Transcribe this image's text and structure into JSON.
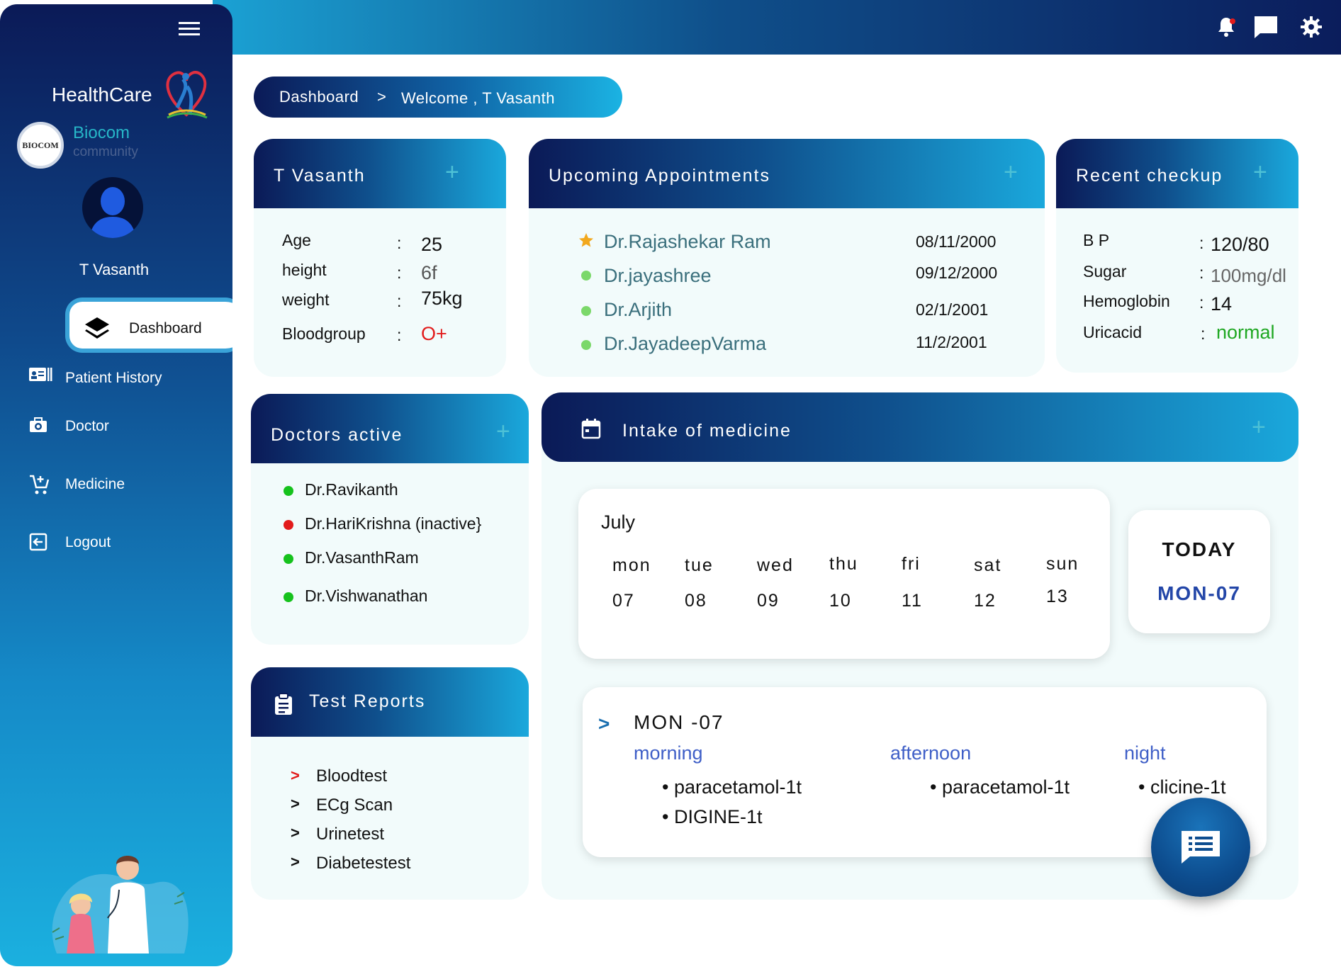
{
  "app": {
    "brand": "HealthCare",
    "org_name": "Biocom",
    "org_sub": "community",
    "org_logo_text": "BIOCOM",
    "user_name": "T Vasanth"
  },
  "nav": {
    "dashboard": "Dashboard",
    "patient_history": "Patient History",
    "doctor": "Doctor",
    "medicine": "Medicine",
    "logout": "Logout"
  },
  "breadcrumb": {
    "home": "Dashboard",
    "separator": ">",
    "current": "Welcome , T Vasanth"
  },
  "profile": {
    "title": "T Vasanth",
    "rows": [
      {
        "label": "Age",
        "sep": ":",
        "value": "25"
      },
      {
        "label": "height",
        "sep": ":",
        "value": "6f"
      },
      {
        "label": "weight",
        "sep": ":",
        "value": "75kg"
      },
      {
        "label": "Bloodgroup",
        "sep": ":",
        "value": "O+"
      }
    ]
  },
  "appointments": {
    "title": "Upcoming Appointments",
    "items": [
      {
        "doctor": "Dr.Rajashekar Ram",
        "date": "08/11/2000"
      },
      {
        "doctor": "Dr.jayashree",
        "date": "09/12/2000"
      },
      {
        "doctor": "Dr.Arjith",
        "date": "02/1/2001"
      },
      {
        "doctor": "Dr.JayadeepVarma",
        "date": "11/2/2001"
      }
    ]
  },
  "checkup": {
    "title": "Recent checkup",
    "rows": [
      {
        "label": "B P",
        "sep": ":",
        "value": "120/80"
      },
      {
        "label": "Sugar",
        "sep": ":",
        "value": "100mg/dl"
      },
      {
        "label": "Hemoglobin",
        "sep": ":",
        "value": "14"
      },
      {
        "label": "Uricacid",
        "sep": ":",
        "value": "normal"
      }
    ]
  },
  "doctors_active": {
    "title": "Doctors active",
    "items": [
      {
        "name": "Dr.Ravikanth",
        "status_color": "#16c21d"
      },
      {
        "name": "Dr.HariKrishna (inactive}",
        "status_color": "#e21b1b"
      },
      {
        "name": "Dr.VasanthRam",
        "status_color": "#16c21d"
      },
      {
        "name": "Dr.Vishwanathan",
        "status_color": "#16c21d"
      }
    ]
  },
  "test_reports": {
    "title": "Test Reports",
    "items": [
      "Bloodtest",
      "ECg Scan",
      "Urinetest",
      "Diabetestest"
    ]
  },
  "intake": {
    "title": "Intake of medicine",
    "month": "July",
    "days": [
      {
        "day": "mon",
        "date": "07"
      },
      {
        "day": "tue",
        "date": "08"
      },
      {
        "day": "wed",
        "date": "09"
      },
      {
        "day": "thu",
        "date": "10"
      },
      {
        "day": "fri",
        "date": "11"
      },
      {
        "day": "sat",
        "date": "12"
      },
      {
        "day": "sun",
        "date": "13"
      }
    ],
    "today_label": "TODAY",
    "today_date": "MON-07",
    "schedule": {
      "day": "MON -07",
      "morning_label": "morning",
      "afternoon_label": "afternoon",
      "night_label": "night",
      "morning": [
        "paracetamol-1t",
        "DIGINE-1t"
      ],
      "afternoon": [
        "paracetamol-1t"
      ],
      "night": [
        "clicine-1t"
      ]
    }
  },
  "colors": {
    "accent_dark": "#0b1a57",
    "accent_light": "#1bb0df",
    "active_green": "#16c21d",
    "alert_red": "#e21b1b",
    "link_blue": "#3f5fc7"
  },
  "icons": {
    "topbar": [
      "bell-icon",
      "chat-icon",
      "gear-icon"
    ],
    "card_add": "plus-icon",
    "fab": "message-list-icon"
  }
}
